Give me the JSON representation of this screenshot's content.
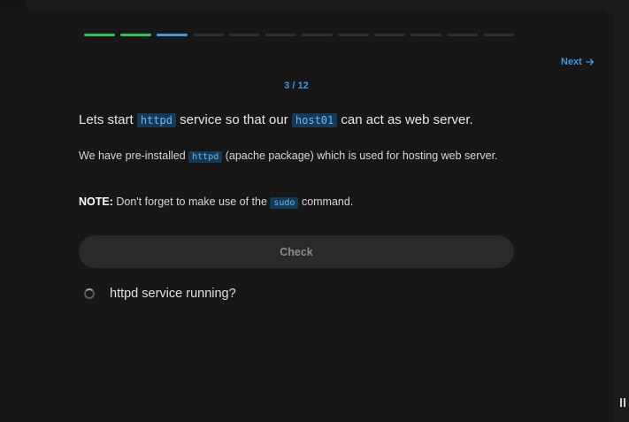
{
  "progress": {
    "current": 3,
    "total": 12,
    "completed": 2,
    "colors": {
      "done": "#22c55e",
      "current": "#3b9ae1",
      "pending": "#2f2f2f"
    }
  },
  "nav": {
    "next_label": "Next",
    "next_icon": "arrow-right-icon"
  },
  "step_counter": "3 / 12",
  "question": {
    "main": {
      "part1": "Lets start ",
      "code1": "httpd",
      "part2": " service so that our ",
      "code2": "host01",
      "part3": " can act as web server."
    },
    "sub": {
      "part1": "We have pre-installed ",
      "code1": "httpd",
      "part2": " (apache package) which is used for hosting web server."
    },
    "note": {
      "label": "NOTE:",
      "part1": " Don't forget to make use of the ",
      "code1": "sudo",
      "part2": " command."
    }
  },
  "check_button_label": "Check",
  "tasks": [
    {
      "label": "httpd service running?",
      "status_icon": "loading-spinner-icon"
    }
  ]
}
